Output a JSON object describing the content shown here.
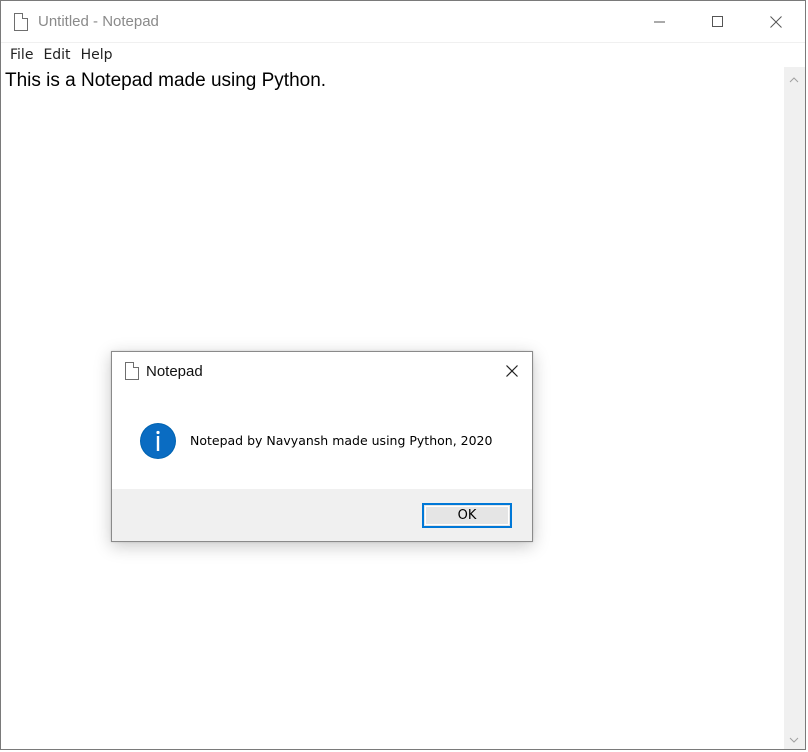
{
  "window": {
    "title": "Untitled - Notepad",
    "controls": [
      "minimize-icon",
      "maximize-icon",
      "close-icon"
    ]
  },
  "menu": {
    "items": [
      {
        "label": "File"
      },
      {
        "label": "Edit"
      },
      {
        "label": "Help"
      }
    ]
  },
  "editor": {
    "content": "This is a Notepad made using Python."
  },
  "dialog": {
    "title": "Notepad",
    "icon": "info-icon",
    "message": "Notepad by Navyansh made using Python, 2020",
    "ok_label": "OK"
  },
  "colors": {
    "accent": "#0078d7",
    "info_icon": "#0063b1",
    "dialog_footer": "#f0f0f0",
    "scrollbar": "#f0f0f0"
  }
}
